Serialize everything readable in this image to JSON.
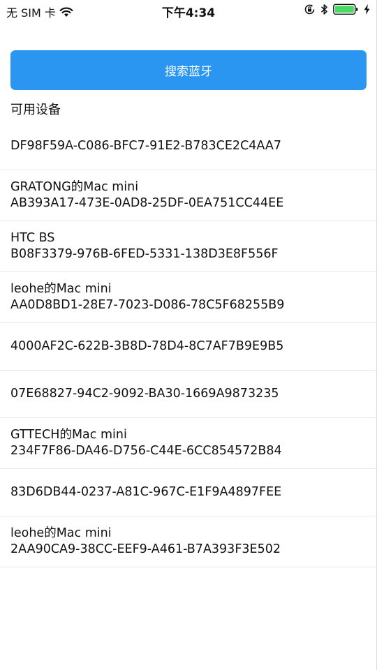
{
  "status_bar": {
    "carrier": "无 SIM 卡",
    "time": "下午4:34"
  },
  "search_button_label": "搜索蓝牙",
  "section_title": "可用设备",
  "devices": [
    {
      "name": "",
      "uuid": "DF98F59A-C086-BFC7-91E2-B783CE2C4AA7"
    },
    {
      "name": "GRATONG的Mac mini",
      "uuid": "AB393A17-473E-0AD8-25DF-0EA751CC44EE"
    },
    {
      "name": "HTC BS",
      "uuid": "B08F3379-976B-6FED-5331-138D3E8F556F"
    },
    {
      "name": "leohe的Mac mini",
      "uuid": "AA0D8BD1-28E7-7023-D086-78C5F68255B9"
    },
    {
      "name": "",
      "uuid": "4000AF2C-622B-3B8D-78D4-8C7AF7B9E9B5"
    },
    {
      "name": "",
      "uuid": "07E68827-94C2-9092-BA30-1669A9873235"
    },
    {
      "name": "GTTECH的Mac mini",
      "uuid": "234F7F86-DA46-D756-C44E-6CC854572B84"
    },
    {
      "name": "",
      "uuid": "83D6DB44-0237-A81C-967C-E1F9A4897FEE"
    },
    {
      "name": "leohe的Mac mini",
      "uuid": "2AA90CA9-38CC-EEF9-A461-B7A393F3E502"
    }
  ],
  "icons": {
    "wifi": "wifi-icon",
    "orientation_lock": "orientation-lock-icon",
    "bluetooth": "bluetooth-icon",
    "battery": "battery-icon",
    "charging": "charging-bolt-icon"
  },
  "colors": {
    "accent": "#2a96f2",
    "battery": "#4cd964"
  }
}
